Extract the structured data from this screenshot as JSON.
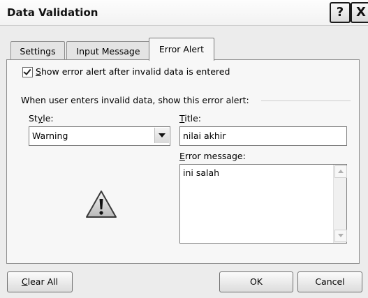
{
  "window": {
    "title": "Data Validation",
    "help_glyph": "?",
    "close_glyph": "X"
  },
  "tabs": [
    {
      "label": "Settings",
      "active": false
    },
    {
      "label": "Input Message",
      "active": false
    },
    {
      "label": "Error Alert",
      "active": true
    }
  ],
  "error_alert": {
    "show_checkbox": {
      "checked": true,
      "mnemonic": "S",
      "rest": "how error alert after invalid data is entered"
    },
    "group_label": "When user enters invalid data, show this error alert:",
    "style": {
      "label_pre": "St",
      "label_mnemonic": "y",
      "label_post": "le:",
      "value": "Warning"
    },
    "title": {
      "label_mnemonic": "T",
      "label_rest": "itle:",
      "value": "nilai akhir"
    },
    "error_message": {
      "label_mnemonic": "E",
      "label_rest": "rror message:",
      "value": "ini salah"
    },
    "icon": "warning-icon"
  },
  "buttons": {
    "clear_all": {
      "mnemonic": "C",
      "rest": "lear All"
    },
    "ok": "OK",
    "cancel": "Cancel"
  }
}
